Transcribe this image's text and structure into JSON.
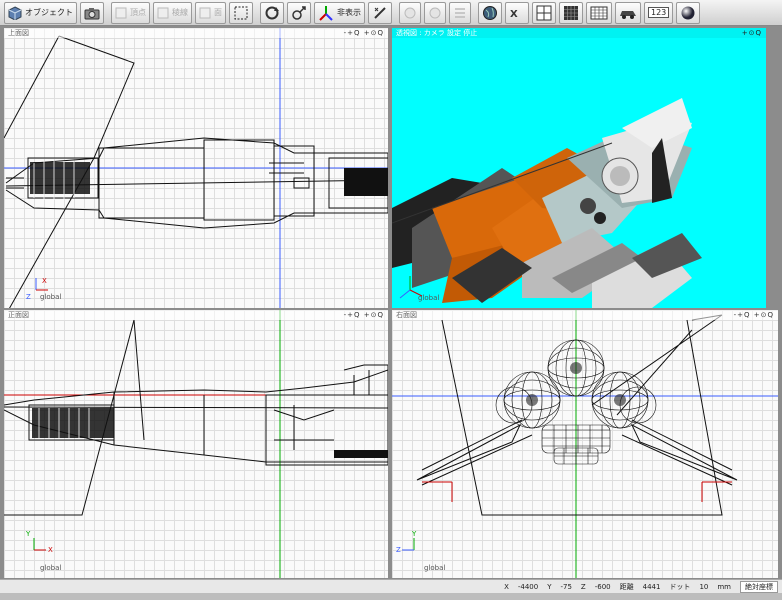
{
  "toolbar": {
    "object_label": "オブジェクト",
    "vertex_label": "頂点",
    "edge_label": "稜線",
    "face_label": "面",
    "hide_label": "非表示",
    "numeric_label": "123"
  },
  "viewports": {
    "top": {
      "title": "上面図",
      "axis_h": "X",
      "axis_v": "Z",
      "space": "global",
      "controls": "-+Q  +⊙Q"
    },
    "perspective": {
      "title": "透視図 : カメラ    設定    停止",
      "space": "global",
      "controls": "+⊙Q"
    },
    "front": {
      "title": "正面図",
      "axis_h": "X",
      "axis_v": "Y",
      "space": "global",
      "controls": "-+Q  +⊙Q"
    },
    "right": {
      "title": "右面図",
      "axis_h": "Z",
      "axis_v": "Y",
      "space": "global",
      "controls": "-+Q  +⊙Q"
    }
  },
  "status": {
    "x_label": "X",
    "x_value": "-4400",
    "y_label": "Y",
    "y_value": "-75",
    "z_label": "Z",
    "z_value": "-600",
    "dist_label": "距離",
    "dist_value": "4441",
    "dot_label": "ドット",
    "dot_value": "10",
    "unit": "mm",
    "mode": "絶対座標"
  },
  "colors": {
    "sky": "#00ffff",
    "hull_orange": "#d9690a",
    "axis_red": "#cc0000",
    "axis_green": "#00aa00",
    "axis_blue": "#3a5cff"
  }
}
